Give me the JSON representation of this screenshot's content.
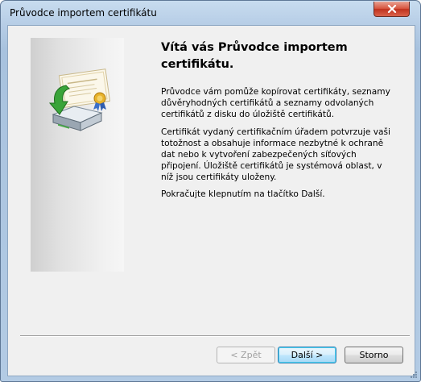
{
  "window": {
    "title": "Průvodce importem certifikátu",
    "close_icon": "close-icon"
  },
  "main": {
    "heading": "Vítá vás Průvodce importem certifikátu.",
    "paragraph1": "Průvodce vám pomůže kopírovat certifikáty, seznamy důvěryhodných certifikátů a seznamy odvolaných certifikátů z disku do úložiště certifikátů.",
    "paragraph2": "Certifikát vydaný certifikačním úřadem potvrzuje vaši totožnost a obsahuje informace nezbytné k ochraně dat nebo k vytvoření zabezpečených síťových připojení. Úložiště certifikátů je systémová oblast, v níž jsou certifikáty uloženy.",
    "paragraph3": "Pokračujte klepnutím na tlačítko Další.",
    "hero_icon": "certificate-import-icon"
  },
  "buttons": {
    "back": "< Zpět",
    "next": "Další >",
    "cancel": "Storno"
  },
  "colors": {
    "title_bar": "#b6cde6",
    "close_button": "#c0321e",
    "client_bg": "#f0f0f0",
    "default_button_border": "#3c7fb1"
  }
}
